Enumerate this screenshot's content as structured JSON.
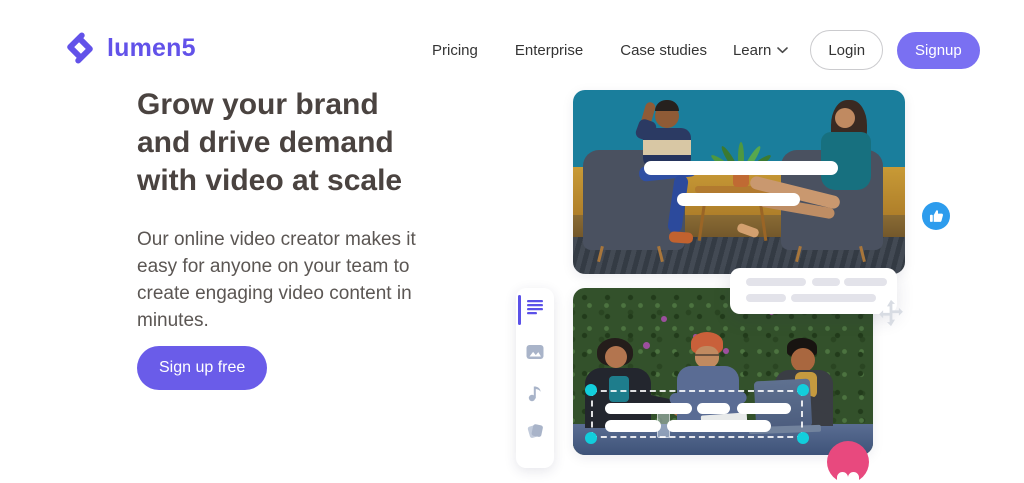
{
  "brand": {
    "name": "lumen5",
    "color": "#6252E9"
  },
  "nav": {
    "items": [
      {
        "label": "Pricing"
      },
      {
        "label": "Enterprise"
      },
      {
        "label": "Case studies"
      },
      {
        "label": "Learn"
      }
    ],
    "login_label": "Login",
    "signup_label": "Signup",
    "signup_color": "#7A70F2"
  },
  "hero": {
    "title_lines": [
      "Grow your brand",
      "and drive demand",
      "with video at scale"
    ],
    "description": "Our online video creator makes it easy for anyone on your team to create engaging video content in minutes.",
    "cta_label": "Sign up free",
    "cta_color": "#6A5CE9"
  },
  "preview": {
    "top_media_alt": "Photo: two people talking in armchairs with white text placeholder bars",
    "bottom_media_alt": "Photo: three people collaborating at an outdoor table with selected text placeholders",
    "toolbar_icons": [
      "text-icon",
      "image-icon",
      "music-icon",
      "scenes-icon"
    ],
    "badge_icons": [
      "thumbs-up-icon",
      "lumen5-badge",
      "move-icon"
    ],
    "colors": {
      "selection_handle": "#12CEDC",
      "like_blue": "#2D9CED",
      "badge_pink": "#E8497E",
      "toolbar_active": "#5B51E8",
      "toolbar_inactive": "#A9B4C9"
    }
  }
}
